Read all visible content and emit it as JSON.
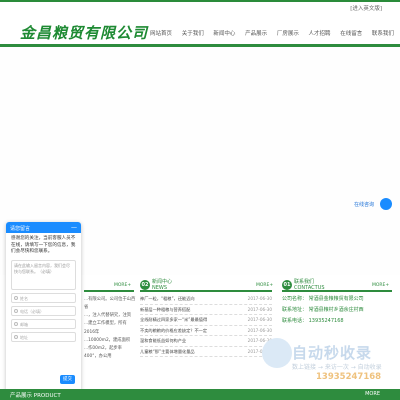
{
  "header": {
    "english_link": "[进入英文版]",
    "logo": "金昌粮贸有限公司"
  },
  "nav": {
    "items": [
      "网站首页",
      "关于我们",
      "新闻中心",
      "产品展示",
      "厂房展示",
      "人才招聘",
      "在线留言",
      "联系我们"
    ]
  },
  "float": {
    "service_label": "在线咨询"
  },
  "chat_panel": {
    "title": "请您留言",
    "close": "—",
    "intro": "感谢您的关注，当前客服人员不在线，请填写一下您的信息，我们会尽快和您联系。",
    "textarea_placeholder": "请在此输入留言内容，我们会尽快与您联系。（必填）",
    "fields": [
      "姓名",
      "电话（必填）",
      "邮箱",
      "地址"
    ],
    "submit": "提交"
  },
  "sections": {
    "about": {
      "more": "MORE+",
      "lines": [
        "...有限公司。公司位于山西省",
        "...，注入代替研究，注资",
        "...建立工作模型，所有2016年",
        "...10000m2，建成面积",
        "...作00m2，起步率400°，办公用"
      ]
    },
    "news": {
      "num": "02",
      "title": "新闻中心",
      "en": "NEWS",
      "more": "MORE+",
      "items": [
        {
          "title": "神厂一粒，“粗粮”，还能迈向",
          "date": "2017-06-30"
        },
        {
          "title": "新基层一种粗粮与营养搭配",
          "date": "2017-06-30"
        },
        {
          "title": "全线耐精过四家多家一“米”最最值得",
          "date": "2017-06-30"
        },
        {
          "title": "不卖的粮粮的价格应差缺定？不一定",
          "date": "2017-06-30"
        },
        {
          "title": "温和食能低益如何构产业",
          "date": "2017-06-30"
        },
        {
          "title": "儿童粮“那”主要体增量化量品",
          "date": "2017-06-30"
        }
      ]
    },
    "contact": {
      "num": "01",
      "title": "联系我们",
      "en": "CONTACTUS",
      "more": "MORE+",
      "company": "公司名称：  常酒县金粮粮贸有限公司",
      "address": "联系地址：  常酒县粮村乡酒余庄村西",
      "phone": "联系电话：  13935247168"
    }
  },
  "watermark": {
    "title": "自动秒收录",
    "subtitle": "数上链接 → 来访一次 → 自动收录",
    "phone": "13935247168"
  },
  "footer": {
    "label": "产品展示 PRODUCT",
    "more": "MORE"
  }
}
